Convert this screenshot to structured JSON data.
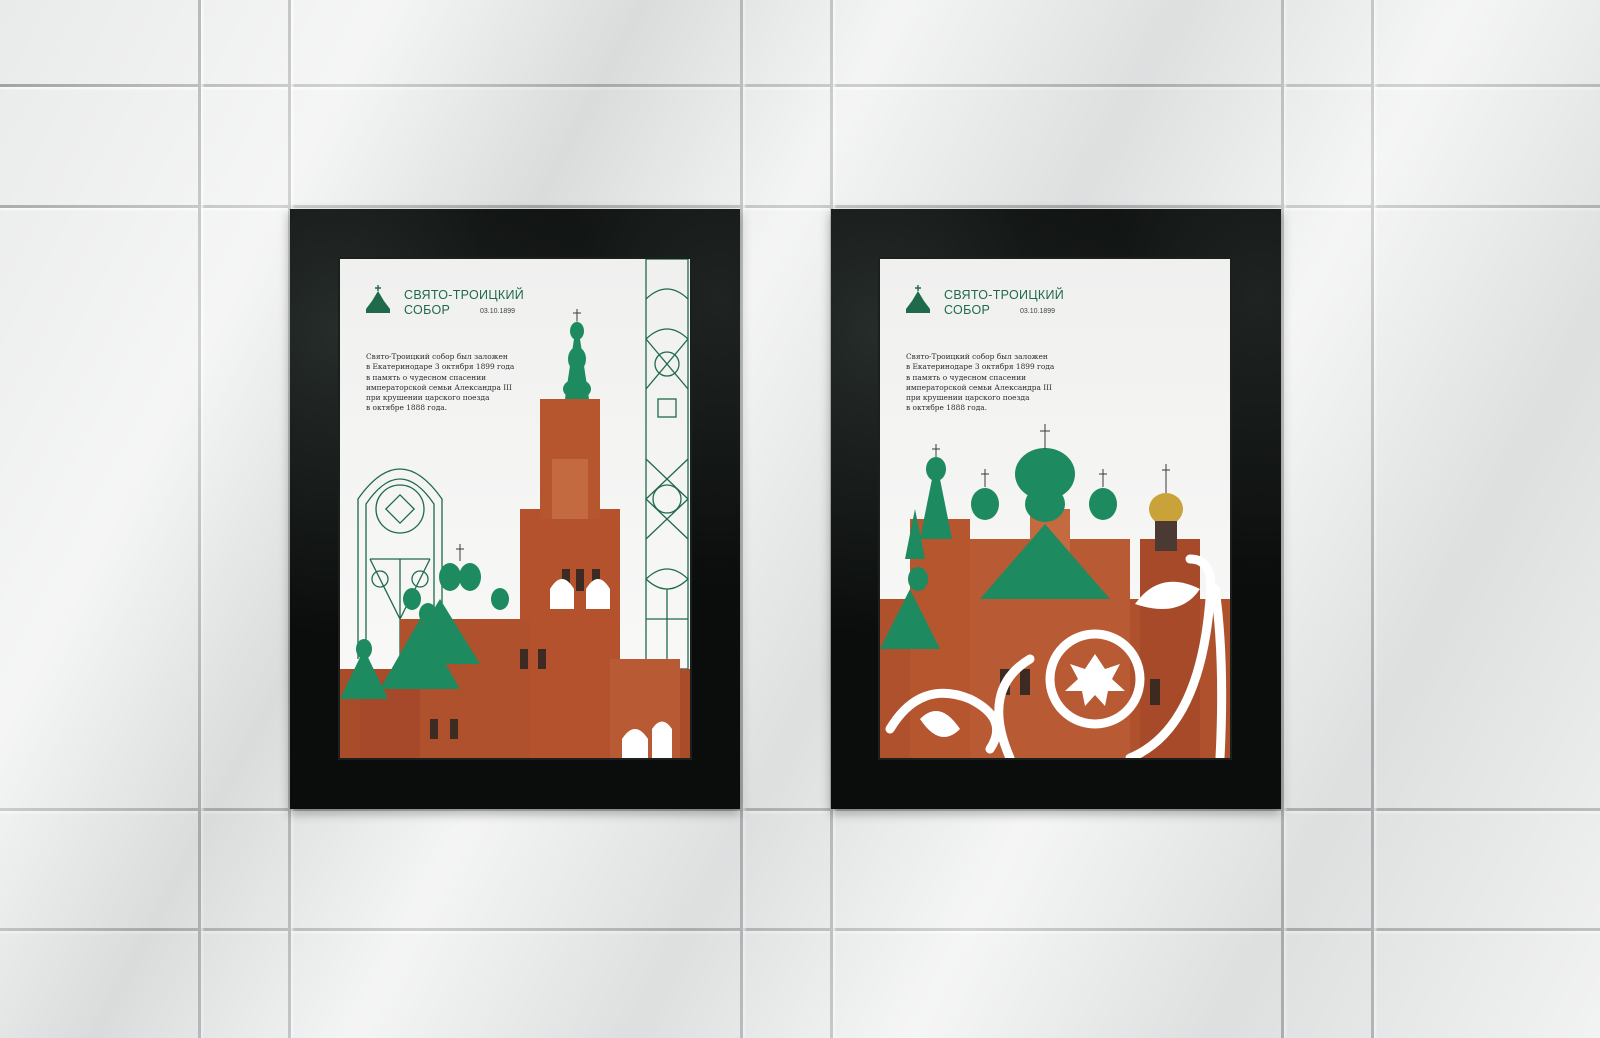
{
  "posters": [
    {
      "title_line1": "СВЯТО-ТРОИЦКИЙ",
      "title_line2": "СОБОР",
      "date": "03.10.1899",
      "description_lines": [
        "Свято-Троицкий собор был заложен",
        "в Екатеринодаре 3 октября 1899 года",
        "в память о чудесном спасении",
        "императорской семьи Александра III",
        "при крушении царского поезда",
        "в октябре 1888 года."
      ]
    },
    {
      "title_line1": "СВЯТО-ТРОИЦКИЙ",
      "title_line2": "СОБОР",
      "date": "03.10.1899",
      "description_lines": [
        "Свято-Троицкий собор был заложен",
        "в Екатеринодаре 3 октября 1899 года",
        "в память о чудесном спасении",
        "императорской семьи Александра III",
        "при крушении царского поезда",
        "в октябре 1888 года."
      ]
    }
  ],
  "colors": {
    "brand_green": "#1f6a4a",
    "dome_green": "#1e8a5f",
    "brick": "#b4522e",
    "gold": "#c9a23a",
    "frame": "#0b0d0d"
  },
  "icons": [
    "church-logo-icon",
    "ornament-pattern",
    "cathedral-illustration",
    "floral-ornament"
  ]
}
